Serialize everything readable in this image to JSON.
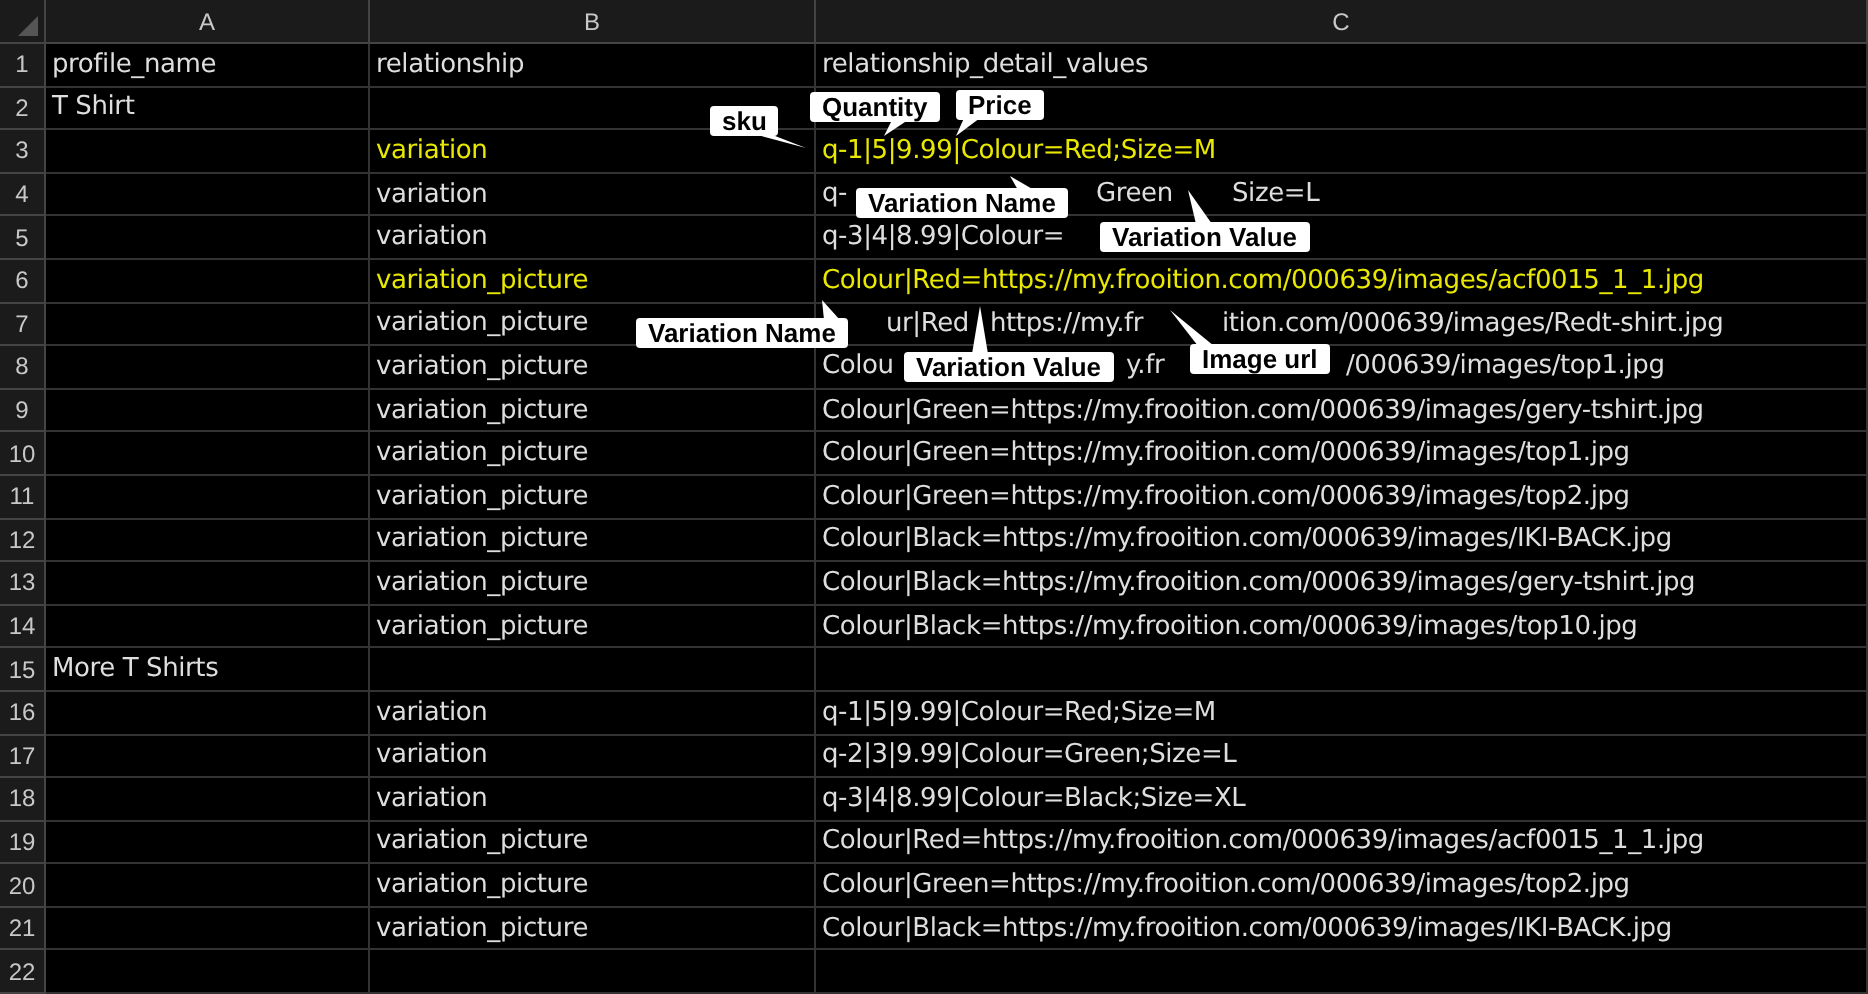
{
  "columns": [
    {
      "letter": "A"
    },
    {
      "letter": "B"
    },
    {
      "letter": "C"
    }
  ],
  "rows": [
    {
      "number": "1",
      "cells": [
        "profile_name",
        "relationship",
        "relationship_detail_values"
      ],
      "highlighted": false
    },
    {
      "number": "2",
      "cells": [
        "T Shirt",
        "",
        ""
      ],
      "highlighted": false
    },
    {
      "number": "3",
      "cells": [
        "",
        "variation",
        "q-1|5|9.99|Colour=Red;Size=M"
      ],
      "highlighted": true
    },
    {
      "number": "4",
      "cells": [
        "",
        "variation",
        [
          "q-",
          "Green",
          "Size=L"
        ]
      ],
      "highlighted": false
    },
    {
      "number": "5",
      "cells": [
        "",
        "variation",
        "q-3|4|8.99|Colour="
      ],
      "highlighted": false
    },
    {
      "number": "6",
      "cells": [
        "",
        "variation_picture",
        "Colour|Red=https://my.frooition.com/000639/images/acf0015_1_1.jpg"
      ],
      "highlighted": true
    },
    {
      "number": "7",
      "cells": [
        "",
        "variation_picture",
        [
          "ur|Red",
          "https://my.fr",
          "ition.com/000639/images/Redt-shirt.jpg"
        ]
      ],
      "highlighted": false
    },
    {
      "number": "8",
      "cells": [
        "",
        "variation_picture",
        [
          "Colou",
          "y.fr",
          "/000639/images/top1.jpg"
        ]
      ],
      "highlighted": false
    },
    {
      "number": "9",
      "cells": [
        "",
        "variation_picture",
        "Colour|Green=https://my.frooition.com/000639/images/gery-tshirt.jpg"
      ],
      "highlighted": false
    },
    {
      "number": "10",
      "cells": [
        "",
        "variation_picture",
        "Colour|Green=https://my.frooition.com/000639/images/top1.jpg"
      ],
      "highlighted": false
    },
    {
      "number": "11",
      "cells": [
        "",
        "variation_picture",
        "Colour|Green=https://my.frooition.com/000639/images/top2.jpg"
      ],
      "highlighted": false
    },
    {
      "number": "12",
      "cells": [
        "",
        "variation_picture",
        "Colour|Black=https://my.frooition.com/000639/images/IKI-BACK.jpg"
      ],
      "highlighted": false
    },
    {
      "number": "13",
      "cells": [
        "",
        "variation_picture",
        "Colour|Black=https://my.frooition.com/000639/images/gery-tshirt.jpg"
      ],
      "highlighted": false
    },
    {
      "number": "14",
      "cells": [
        "",
        "variation_picture",
        "Colour|Black=https://my.frooition.com/000639/images/top10.jpg"
      ],
      "highlighted": false
    },
    {
      "number": "15",
      "cells": [
        "More T Shirts",
        "",
        ""
      ],
      "highlighted": false
    },
    {
      "number": "16",
      "cells": [
        "",
        "variation",
        "q-1|5|9.99|Colour=Red;Size=M"
      ],
      "highlighted": false
    },
    {
      "number": "17",
      "cells": [
        "",
        "variation",
        "q-2|3|9.99|Colour=Green;Size=L"
      ],
      "highlighted": false
    },
    {
      "number": "18",
      "cells": [
        "",
        "variation",
        "q-3|4|8.99|Colour=Black;Size=XL"
      ],
      "highlighted": false
    },
    {
      "number": "19",
      "cells": [
        "",
        "variation_picture",
        "Colour|Red=https://my.frooition.com/000639/images/acf0015_1_1.jpg"
      ],
      "highlighted": false
    },
    {
      "number": "20",
      "cells": [
        "",
        "variation_picture",
        "Colour|Green=https://my.frooition.com/000639/images/top2.jpg"
      ],
      "highlighted": false
    },
    {
      "number": "21",
      "cells": [
        "",
        "variation_picture",
        "Colour|Black=https://my.frooition.com/000639/images/IKI-BACK.jpg"
      ],
      "highlighted": false
    },
    {
      "number": "22",
      "cells": [
        "",
        "",
        ""
      ]
    }
  ],
  "callouts": [
    {
      "text": "sku"
    },
    {
      "text": "Quantity"
    },
    {
      "text": "Price"
    },
    {
      "text": "Variation Name"
    },
    {
      "text": "Variation Value"
    },
    {
      "text": "Variation Name"
    },
    {
      "text": "Variation Value"
    },
    {
      "text": "Image url"
    }
  ]
}
